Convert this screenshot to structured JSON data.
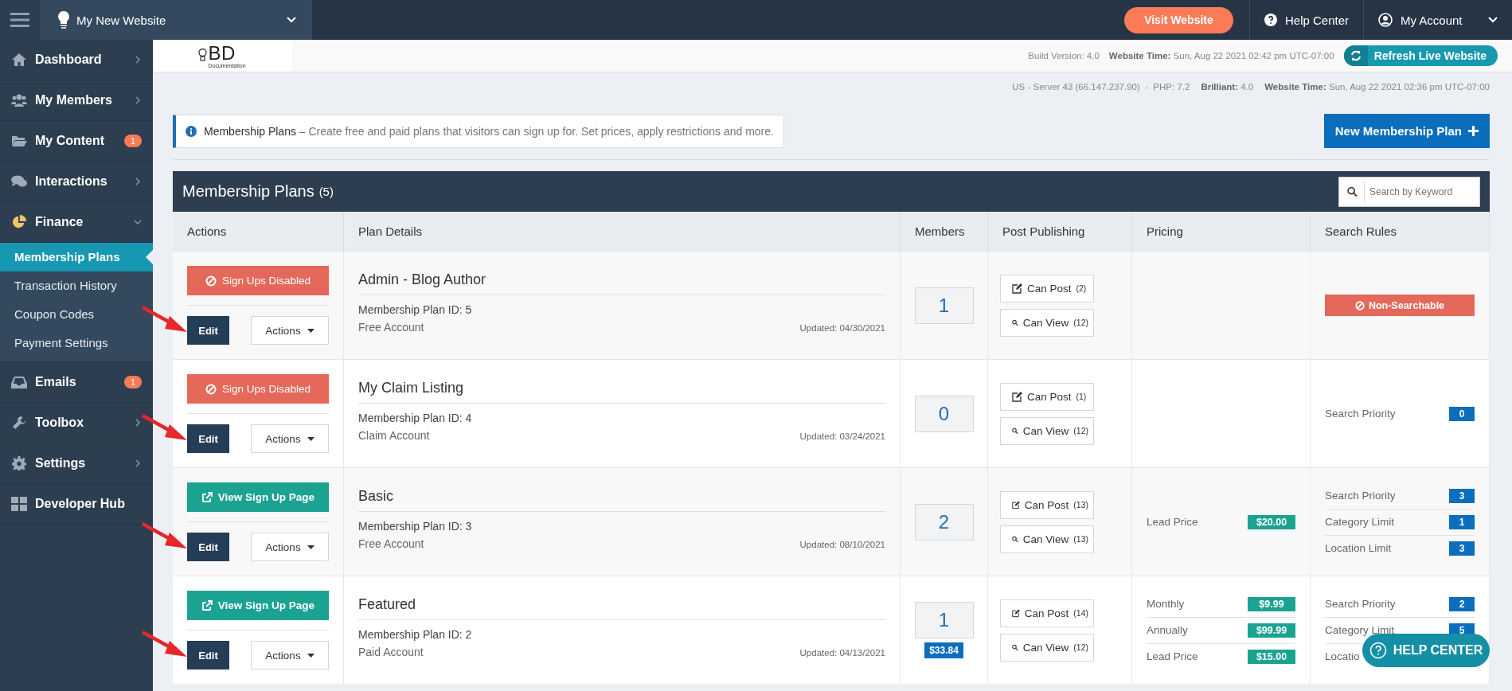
{
  "topbar": {
    "site": "My New Website",
    "visit_button": "Visit Website",
    "help": "Help Center",
    "account": "My Account"
  },
  "sidebar": {
    "items": [
      {
        "label": "Dashboard",
        "expanded": false
      },
      {
        "label": "My Members",
        "expanded": false
      },
      {
        "label": "My Content",
        "badge": "1"
      },
      {
        "label": "Interactions",
        "expanded": false
      },
      {
        "label": "Finance",
        "expanded": true,
        "children": [
          {
            "label": "Membership Plans",
            "selected": true
          },
          {
            "label": "Transaction History",
            "selected": false
          },
          {
            "label": "Coupon Codes",
            "selected": false
          },
          {
            "label": "Payment Settings",
            "selected": false
          }
        ]
      },
      {
        "label": "Emails",
        "badge": "1"
      },
      {
        "label": "Toolbox",
        "expanded": false
      },
      {
        "label": "Settings",
        "expanded": false
      },
      {
        "label": "Developer Hub"
      }
    ]
  },
  "info_bar": {
    "logo": "BD",
    "logo_sub": "Documentation",
    "build": "Build Version: 4.0",
    "time": "**Website Time:** Sun, Aug 22 2021 02:42 pm UTC-07:00",
    "refresh_button": "Refresh Live Website"
  },
  "server_line": [
    "US - Server 43 (66.147.237.90)  -  PHP: 7.2",
    "**Brilliant:** 4.0",
    "**Website Time:** Sun, Aug 22 2021 02:36 pm UTC-07:00"
  ],
  "notice": "**Membership Plans** – Create free and paid plans that visitors can sign up for. Set prices, apply restrictions and more.",
  "new_button": "New Membership Plan",
  "panel": {
    "title": "Membership Plans",
    "count": "(5)",
    "search": {
      "placeholder": "Search by Keyword"
    }
  },
  "table": {
    "columns": [
      "Actions",
      "Plan Details",
      "Members",
      "Post Publishing",
      "Pricing",
      "Search Rules"
    ],
    "rows": [
      {
        "signup": {
          "kind": "disabled",
          "label": "Sign Ups Disabled"
        },
        "edit": "Edit",
        "actions": "Actions",
        "name": "Admin - Blog Author",
        "plan_id": "Membership Plan ID: 5",
        "account": "Free Account",
        "updated": "Updated: 04/30/2021",
        "members": "1",
        "post": {
          "label": "Can Post",
          "count": "(2)"
        },
        "view": {
          "label": "Can View",
          "count": "(12)"
        },
        "pricing": [],
        "search_rules": [
          {
            "kind": "badge",
            "label": "Non-Searchable"
          }
        ]
      },
      {
        "signup": {
          "kind": "disabled",
          "label": "Sign Ups Disabled"
        },
        "edit": "Edit",
        "actions": "Actions",
        "name": "My Claim Listing",
        "plan_id": "Membership Plan ID: 4",
        "account": "Claim Account",
        "updated": "Updated: 03/24/2021",
        "members": "0",
        "post": {
          "label": "Can Post",
          "count": "(1)"
        },
        "view": {
          "label": "Can View",
          "count": "(12)"
        },
        "pricing": [],
        "search_rules": [
          {
            "kind": "rule",
            "label": "Search Priority",
            "value": "0"
          }
        ]
      },
      {
        "signup": {
          "kind": "view",
          "label": "View Sign Up Page"
        },
        "edit": "Edit",
        "actions": "Actions",
        "name": "Basic",
        "plan_id": "Membership Plan ID: 3",
        "account": "Free Account",
        "updated": "Updated: 08/10/2021",
        "members": "2",
        "post": {
          "label": "Can Post",
          "count": "(13)"
        },
        "view": {
          "label": "Can View",
          "count": "(13)"
        },
        "pricing": [
          {
            "label": "Lead Price",
            "price": "$20.00"
          }
        ],
        "search_rules": [
          {
            "kind": "rule",
            "label": "Search Priority",
            "value": "3"
          },
          {
            "kind": "rule",
            "label": "Category Limit",
            "value": "1"
          },
          {
            "kind": "rule",
            "label": "Location Limit",
            "value": "3"
          }
        ]
      },
      {
        "signup": {
          "kind": "view",
          "label": "View Sign Up Page"
        },
        "edit": "Edit",
        "actions": "Actions",
        "name": "Featured",
        "plan_id": "Membership Plan ID: 2",
        "account": "Paid Account",
        "updated": "Updated: 04/13/2021",
        "members": "1",
        "members_badge": "$33.84",
        "post": {
          "label": "Can Post",
          "count": "(14)"
        },
        "view": {
          "label": "Can View",
          "count": "(12)"
        },
        "pricing": [
          {
            "label": "Monthly",
            "price": "$9.99"
          },
          {
            "label": "Annually",
            "price": "$99.99"
          },
          {
            "label": "Lead Price",
            "price": "$15.00"
          }
        ],
        "search_rules": [
          {
            "kind": "rule",
            "label": "Search Priority",
            "value": "2"
          },
          {
            "kind": "rule",
            "label": "Category Limit",
            "value": "5"
          },
          {
            "kind": "rule",
            "label": "Locatio"
          }
        ]
      }
    ]
  },
  "help_button": "HELP CENTER"
}
